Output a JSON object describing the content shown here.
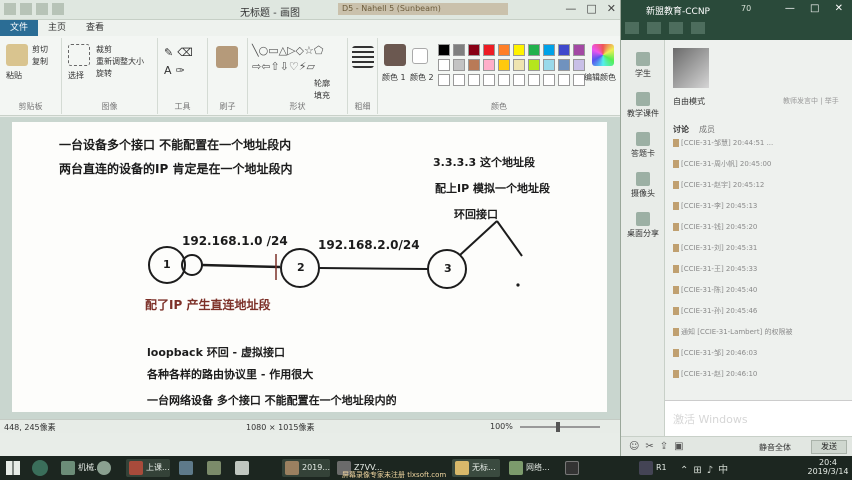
{
  "paint": {
    "title": "无标题 - 画图",
    "overlay_text": "D5 - Nahell 5 (Sunbeam)",
    "win_controls": [
      "—",
      "□",
      "✕"
    ],
    "menu_tabs": [
      "文件",
      "主页",
      "查看"
    ],
    "ribbon": {
      "clipboard": {
        "paste": "粘贴",
        "cut": "剪切",
        "copy": "复制",
        "label": "剪贴板"
      },
      "image": {
        "select": "选择",
        "crop": "裁剪",
        "resize": "重新调整大小",
        "rotate": "旋转",
        "label": "图像"
      },
      "tools": {
        "label": "工具"
      },
      "brushes": {
        "label": "刷子"
      },
      "shapes": {
        "outline": "轮廓",
        "fill": "填充",
        "label": "形状"
      },
      "size": {
        "label": "粗细"
      },
      "colors": {
        "color1": "颜色 1",
        "color2": "颜色 2",
        "edit": "编辑颜色",
        "label": "颜色"
      }
    },
    "canvas": {
      "line1": "一台设备多个接口 不能配置在一个地址段内",
      "line2": "两台直连的设备的IP 肯定是在一个地址段内",
      "r1": "3.3.3.3 这个地址段",
      "r2": "配上IP 模拟一个地址段",
      "r3": "环回接口",
      "net1": "192.168.1.0 /24",
      "net2": "192.168.2.0/24",
      "node1": "1",
      "node2": "2",
      "node3": "3",
      "note_red": "配了IP  产生直连地址段",
      "b1": "loopback 环回 - 虚拟接口",
      "b2": "各种各样的路由协议里  - 作用很大",
      "b3": "一台网络设备 多个接口 不能配置在一个地址段内的"
    },
    "status": {
      "coords": "448, 245像素",
      "size": "1080 × 1015像素",
      "zoom": "100%"
    }
  },
  "chat": {
    "title": "新盟教育-CCNP",
    "stats": "70",
    "win_controls": "— □ ✕",
    "sidebar": [
      "学生",
      "教学课件",
      "答题卡",
      "摄像头",
      "桌面分享"
    ],
    "mode": "自由模式",
    "mode_right": "教师发言中 | 举手",
    "tabs": [
      "讨论",
      "成员"
    ],
    "messages": [
      "[CCIE-31-邹慧] 20:44:51 ...",
      "[CCIE-31-周小帆] 20:45:00",
      "[CCIE-31-赵宇] 20:45:12",
      "[CCIE-31-李] 20:45:13",
      "[CCIE-31-钱] 20:45:20",
      "[CCIE-31-刘] 20:45:31",
      "[CCIE-31-王] 20:45:33",
      "[CCIE-31-陈] 20:45:40",
      "[CCIE-31-孙] 20:45:46",
      "通知 [CCIE-31-Lambert] 的权限被",
      "[CCIE-31-邹] 20:46:03",
      "[CCIE-31-赵] 20:46:10"
    ],
    "watermark": "激活 Windows",
    "bottom_btns": [
      "静音全体",
      "发送"
    ]
  },
  "taskbar": {
    "items": [
      "机械...",
      "上课...",
      "2019...",
      "Z7VV...",
      "无标...",
      "网络...",
      "R1"
    ],
    "watermark": "屏幕录像专家未注册 tlxsoft.com",
    "time": "20:4",
    "date": "2019/3/14"
  },
  "colors": {
    "palette": [
      "#000000",
      "#7f7f7f",
      "#880015",
      "#ed1c24",
      "#ff7f27",
      "#fff200",
      "#22b14c",
      "#00a2e8",
      "#3f48cc",
      "#a349a4",
      "#ffffff",
      "#c3c3c3",
      "#b97a57",
      "#ffaec9",
      "#ffc90e",
      "#efe4b0",
      "#b5e61d",
      "#99d9ea",
      "#7092be",
      "#c8bfe7"
    ]
  }
}
